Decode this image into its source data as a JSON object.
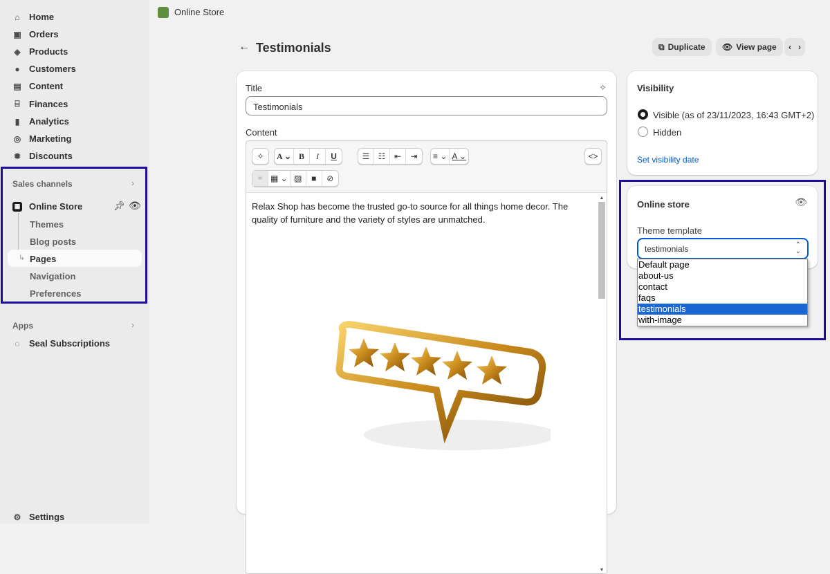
{
  "sidebar": {
    "items": [
      {
        "label": "Home",
        "icon": "home-icon"
      },
      {
        "label": "Orders",
        "icon": "orders-icon"
      },
      {
        "label": "Products",
        "icon": "tag-icon"
      },
      {
        "label": "Customers",
        "icon": "person-icon"
      },
      {
        "label": "Content",
        "icon": "content-icon"
      },
      {
        "label": "Finances",
        "icon": "bank-icon"
      },
      {
        "label": "Analytics",
        "icon": "chart-icon"
      },
      {
        "label": "Marketing",
        "icon": "target-icon"
      },
      {
        "label": "Discounts",
        "icon": "discount-icon"
      }
    ],
    "sales_channels": "Sales channels",
    "online_store": "Online Store",
    "sub_items": [
      "Themes",
      "Blog posts",
      "Pages",
      "Navigation",
      "Preferences"
    ],
    "apps": "Apps",
    "seal": "Seal Subscriptions",
    "settings": "Settings"
  },
  "topbar": {
    "title": "Online Store"
  },
  "page": {
    "title": "Testimonials",
    "duplicate": "Duplicate",
    "view_page": "View page"
  },
  "editor": {
    "title_label": "Title",
    "title_value": "Testimonials",
    "content_label": "Content",
    "body": "Relax Shop has become the trusted go-to source for all things home decor. The quality of furniture and the variety of styles are unmatched."
  },
  "visibility": {
    "heading": "Visibility",
    "visible": "Visible (as of 23/11/2023, 16:43 GMT+2)",
    "hidden": "Hidden",
    "set_date": "Set visibility date",
    "selected": "visible"
  },
  "online_store": {
    "heading": "Online store",
    "template_label": "Theme template",
    "template_value": "testimonials",
    "options": [
      "Default page",
      "about-us",
      "contact",
      "faqs",
      "testimonials",
      "with-image"
    ]
  },
  "colors": {
    "highlight": "#1e0d9a",
    "link": "#005bd3",
    "selected_option": "#1a66d2"
  }
}
